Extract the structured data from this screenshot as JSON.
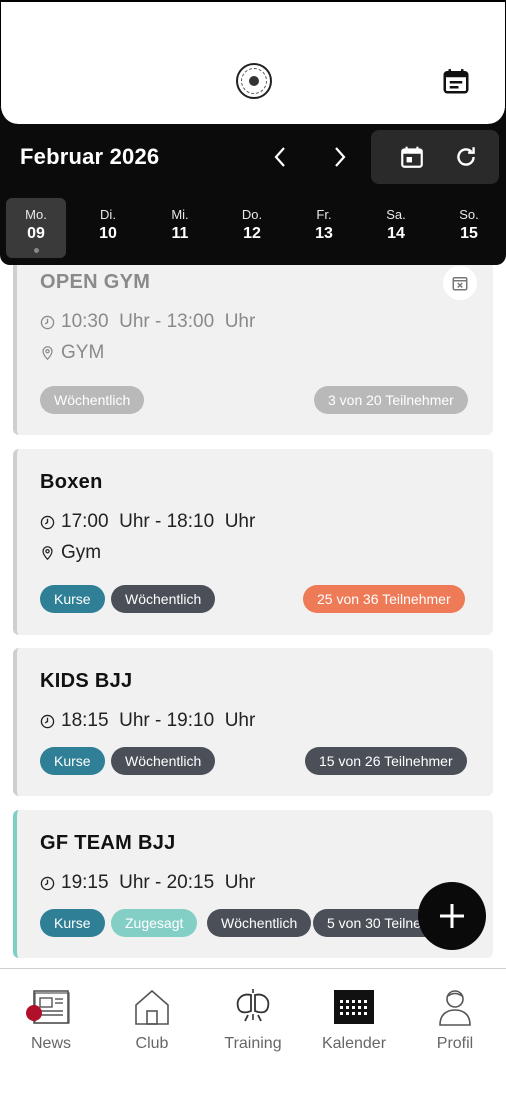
{
  "header": {
    "logo_icon": "club-logo",
    "calendar_icon": "calendar-icon"
  },
  "calendar": {
    "month_title": "Februar 2026",
    "days": [
      {
        "name": "Mo.",
        "date": "09",
        "active": true
      },
      {
        "name": "Di.",
        "date": "10"
      },
      {
        "name": "Mi.",
        "date": "11"
      },
      {
        "name": "Do.",
        "date": "12"
      },
      {
        "name": "Fr.",
        "date": "13"
      },
      {
        "name": "Sa.",
        "date": "14"
      },
      {
        "name": "So.",
        "date": "15"
      }
    ]
  },
  "events": [
    {
      "title": "OPEN GYM",
      "time": "10:30  Uhr - 13:00  Uhr",
      "location": "GYM",
      "badges": [
        "Wöchentlich"
      ],
      "participants": "3 von 20 Teilnehmer"
    },
    {
      "title": "Boxen",
      "time": "17:00  Uhr - 18:10  Uhr",
      "location": "Gym",
      "badges": [
        "Kurse",
        "Wöchentlich"
      ],
      "participants": "25 von 36 Teilnehmer"
    },
    {
      "title": "KIDS BJJ",
      "time": "18:15  Uhr - 19:10  Uhr",
      "badges": [
        "Kurse",
        "Wöchentlich"
      ],
      "participants": "15 von 26 Teilnehmer"
    },
    {
      "title": "GF TEAM BJJ",
      "time": "19:15  Uhr - 20:15  Uhr",
      "badges": [
        "Kurse",
        "Zugesagt",
        "Wöchentlich"
      ],
      "participants": "5 von 30 Teilnehmer"
    }
  ],
  "bottom_nav": [
    {
      "label": "News",
      "icon": "news-icon"
    },
    {
      "label": "Club",
      "icon": "home-icon"
    },
    {
      "label": "Training",
      "icon": "gloves-icon"
    },
    {
      "label": "Kalender",
      "icon": "calendar-grid-icon",
      "active": true
    },
    {
      "label": "Profil",
      "icon": "profile-icon"
    }
  ],
  "colors": {
    "accent_teal": "#84cfc5",
    "kurse_blue": "#2f7f96",
    "participants_orange": "#ef7a57",
    "notification_red": "#b0102a"
  }
}
